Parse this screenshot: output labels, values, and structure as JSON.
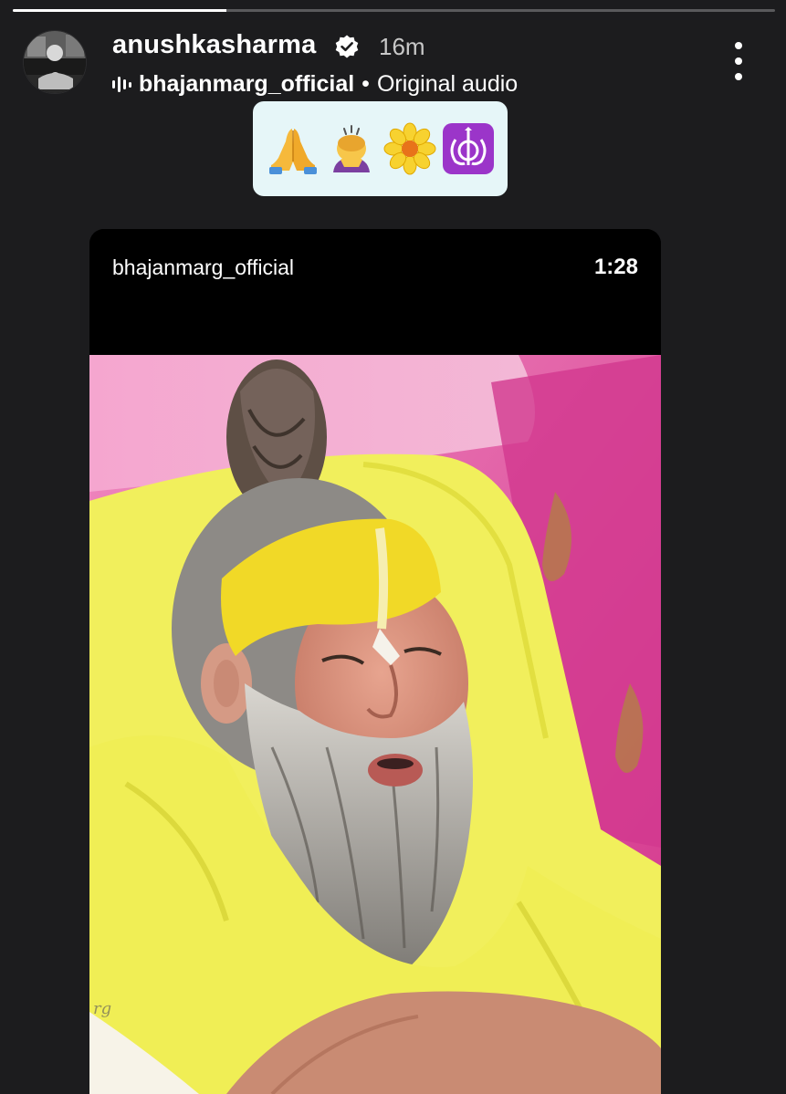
{
  "story": {
    "progress": 0.28
  },
  "header": {
    "username": "anushkasharma",
    "verified": true,
    "timestamp": "16m",
    "audio": {
      "author": "bhajanmarg_official",
      "separator": "•",
      "label": "Original audio"
    }
  },
  "sticker": {
    "emojis": [
      "🙏",
      "🙇‍♀️",
      "🌼",
      "☬"
    ]
  },
  "reel": {
    "author": "bhajanmarg_official",
    "duration": "1:28"
  },
  "colors": {
    "background": "#1c1c1e",
    "sticker_bg": "#e6f6f8",
    "wall_pink": "#e0448f",
    "cloth_yellow": "#f1ef5c"
  },
  "icons": {
    "verified": "verified-badge-icon",
    "audio": "audio-bars-icon",
    "more": "more-vertical-icon"
  }
}
